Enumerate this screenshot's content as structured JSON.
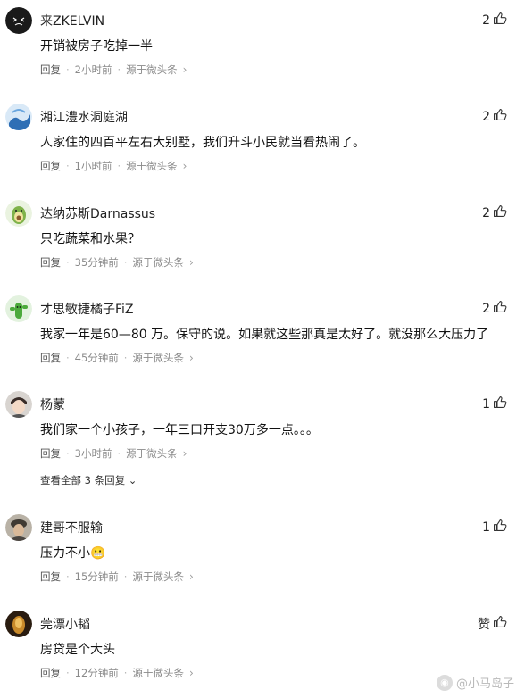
{
  "comments": [
    {
      "name": "来ZKELVIN",
      "text": "开销被房子吃掉一半",
      "reply": "回复",
      "time": "2小时前",
      "source": "源于微头条",
      "likes": "2"
    },
    {
      "name": "湘江澧水洞庭湖",
      "text": "人家住的四百平左右大别墅，我们升斗小民就当看热闹了。",
      "reply": "回复",
      "time": "1小时前",
      "source": "源于微头条",
      "likes": "2"
    },
    {
      "name": "达纳苏斯Darnassus",
      "text": "只吃蔬菜和水果？",
      "reply": "回复",
      "time": "35分钟前",
      "source": "源于微头条",
      "likes": "2"
    },
    {
      "name": "才思敏捷橘子FiZ",
      "text": "我家一年是60—80 万。保守的说。如果就这些那真是太好了。就没那么大压力了",
      "reply": "回复",
      "time": "45分钟前",
      "source": "源于微头条",
      "likes": "2"
    },
    {
      "name": "杨蒙",
      "text": "我们家一个小孩子，一年三口开支30万多一点。。。",
      "reply": "回复",
      "time": "3小时前",
      "source": "源于微头条",
      "likes": "1"
    },
    {
      "name": "建哥不服输",
      "text": "压力不小😬",
      "reply": "回复",
      "time": "15分钟前",
      "source": "源于微头条",
      "likes": "1"
    },
    {
      "name": "莞漂小韬",
      "text": "房贷是个大头",
      "reply": "回复",
      "time": "12分钟前",
      "source": "源于微头条",
      "likes": "赞"
    }
  ],
  "view_replies": "查看全部 3 条回复",
  "watermark": "@小马岛子",
  "colors": {
    "meta": "#8a8a8a",
    "text": "#111111",
    "background": "#ffffff"
  }
}
